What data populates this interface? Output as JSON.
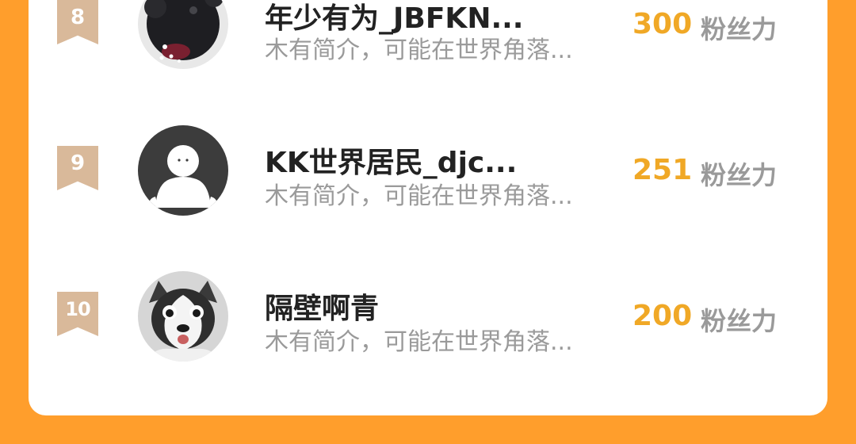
{
  "leaderboard": {
    "score_unit": "粉丝力",
    "rows": [
      {
        "rank": "8",
        "name": "年少有为_JBFKN...",
        "bio": "木有简介，可能在世界角落...",
        "score": "300",
        "avatar": "dark-character-avatar"
      },
      {
        "rank": "9",
        "name": "KK世界居民_djc...",
        "bio": "木有简介，可能在世界角落...",
        "score": "251",
        "avatar": "default-user-avatar"
      },
      {
        "rank": "10",
        "name": "隔壁啊青",
        "bio": "木有简介，可能在世界角落...",
        "score": "200",
        "avatar": "husky-dog-avatar"
      }
    ]
  },
  "colors": {
    "background": "#FF9E2C",
    "card": "#FFFFFF",
    "rank_badge": "#D9B99A",
    "score": "#F0A826",
    "secondary_text": "#9A9A9A",
    "name_text": "#222222"
  }
}
